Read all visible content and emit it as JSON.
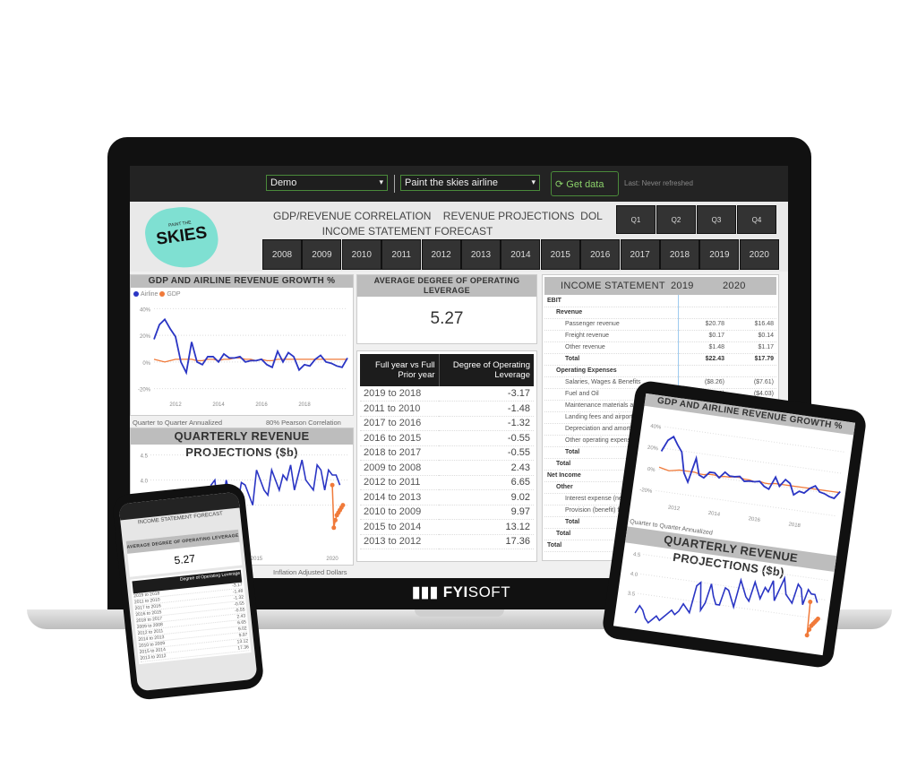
{
  "topbar": {
    "dataset": "Demo",
    "company": "Paint the skies airline",
    "get_data": "Get data",
    "last_refresh": "Last: Never refreshed"
  },
  "brand": {
    "logo_small": "PAINT THE",
    "logo_big": "SKIES",
    "footer_bold": "FYI",
    "footer_rest": "SOFT"
  },
  "header": {
    "title_line1": "GDP/REVENUE CORRELATION    REVENUE PROJECTIONS  DOL",
    "title_line2": "INCOME STATEMENT FORECAST",
    "quarters": [
      "Q1",
      "Q2",
      "Q3",
      "Q4"
    ],
    "years": [
      "2008",
      "2009",
      "2010",
      "2011",
      "2012",
      "2013",
      "2014",
      "2015",
      "2016",
      "2017",
      "2018",
      "2019",
      "2020"
    ]
  },
  "gdp_chart": {
    "title": "GDP AND AIRLINE REVENUE GROWTH %",
    "caption_left": "Quarter to Quarter Annualized",
    "caption_right": "80% Pearson Correlation"
  },
  "rev_chart": {
    "title": "QUARTERLY REVENUE PROJECTIONS ($b)",
    "caption": "Inflation Adjusted Dollars"
  },
  "dol": {
    "title": "AVERAGE DEGREE OF OPERATING LEVERAGE",
    "value": "5.27",
    "col1": "Full year vs Full Prior year",
    "col2": "Degree of Operating Leverage",
    "rows": [
      [
        "2019 to 2018",
        "-3.17"
      ],
      [
        "2011 to 2010",
        "-1.48"
      ],
      [
        "2017 to 2016",
        "-1.32"
      ],
      [
        "2016 to 2015",
        "-0.55"
      ],
      [
        "2018 to 2017",
        "-0.55"
      ],
      [
        "2009 to 2008",
        "2.43"
      ],
      [
        "2012 to 2011",
        "6.65"
      ],
      [
        "2014 to 2013",
        "9.02"
      ],
      [
        "2010 to 2009",
        "9.97"
      ],
      [
        "2015 to 2014",
        "13.12"
      ],
      [
        "2013 to 2012",
        "17.36"
      ]
    ]
  },
  "income": {
    "title": "INCOME STATEMENT",
    "col_2019": "2019",
    "col_2020": "2020",
    "rows": [
      {
        "label": "EBIT",
        "level": 0,
        "bold": true,
        "v19": "",
        "v20": ""
      },
      {
        "label": "Revenue",
        "level": 1,
        "bold": true,
        "v19": "",
        "v20": ""
      },
      {
        "label": "Passenger revenue",
        "level": 2,
        "bold": false,
        "v19": "$20.78",
        "v20": "$16.48"
      },
      {
        "label": "Freight revenue",
        "level": 2,
        "bold": false,
        "v19": "$0.17",
        "v20": "$0.14"
      },
      {
        "label": "Other revenue",
        "level": 2,
        "bold": false,
        "v19": "$1.48",
        "v20": "$1.17"
      },
      {
        "label": "Total",
        "level": 2,
        "bold": true,
        "v19": "$22.43",
        "v20": "$17.79"
      },
      {
        "label": "Operating Expenses",
        "level": 1,
        "bold": true,
        "v19": "",
        "v20": ""
      },
      {
        "label": "Salaries, Wages & Benefits",
        "level": 2,
        "bold": false,
        "v19": "($8.26)",
        "v20": "($7.61)"
      },
      {
        "label": "Fuel and Oil",
        "level": 2,
        "bold": false,
        "v19": "($4.33)",
        "v20": "($4.03)"
      },
      {
        "label": "Maintenance materials and repairs",
        "level": 2,
        "bold": false,
        "v19": "",
        "v20": ""
      },
      {
        "label": "Landing fees and airport rentals",
        "level": 2,
        "bold": false,
        "v19": "",
        "v20": ""
      },
      {
        "label": "Depreciation and amortization",
        "level": 2,
        "bold": false,
        "v19": "",
        "v20": ""
      },
      {
        "label": "Other operating expenses",
        "level": 2,
        "bold": false,
        "v19": "",
        "v20": ""
      },
      {
        "label": "Total",
        "level": 2,
        "bold": true,
        "v19": "",
        "v20": ""
      },
      {
        "label": "Total",
        "level": 1,
        "bold": true,
        "v19": "",
        "v20": ""
      },
      {
        "label": "Net Income",
        "level": 0,
        "bold": true,
        "v19": "",
        "v20": ""
      },
      {
        "label": "Other",
        "level": 1,
        "bold": true,
        "v19": "",
        "v20": ""
      },
      {
        "label": "Interest expense (net)",
        "level": 2,
        "bold": false,
        "v19": "",
        "v20": ""
      },
      {
        "label": "Provision (benefit) for income",
        "level": 2,
        "bold": false,
        "v19": "",
        "v20": ""
      },
      {
        "label": "Total",
        "level": 2,
        "bold": true,
        "v19": "",
        "v20": ""
      },
      {
        "label": "Total",
        "level": 1,
        "bold": true,
        "v19": "",
        "v20": ""
      },
      {
        "label": "Total",
        "level": 0,
        "bold": true,
        "v19": "",
        "v20": ""
      }
    ]
  },
  "chart_data": [
    {
      "type": "line",
      "title": "GDP AND AIRLINE REVENUE GROWTH %",
      "x_start": 2011,
      "x_step": 0.25,
      "xticks": [
        "2012",
        "2014",
        "2016",
        "2018"
      ],
      "yticks": [
        "40%",
        "20%",
        "0%",
        "-20%"
      ],
      "ylim": [
        -25,
        45
      ],
      "grid": true,
      "legend": "top-left",
      "colors": {
        "Airline": "#2a35c4",
        "GDP": "#f07a3a"
      },
      "series": [
        {
          "name": "Airline",
          "values": [
            17,
            28,
            32,
            25,
            19,
            0,
            -8,
            15,
            0,
            -2,
            4,
            4,
            0,
            6,
            3,
            3,
            4,
            0,
            1,
            1,
            2,
            -2,
            -4,
            8,
            0,
            7,
            4,
            -6,
            -2,
            -3,
            2,
            5,
            0,
            -1,
            -3,
            -4,
            3
          ]
        },
        {
          "name": "GDP",
          "values": [
            2,
            1,
            0,
            1,
            2,
            2,
            2,
            2,
            1,
            1,
            2,
            2,
            1,
            2,
            2,
            3,
            3,
            2,
            2,
            1,
            2,
            1,
            1,
            2,
            2,
            2,
            2,
            2,
            2,
            2,
            2,
            2,
            2,
            2,
            2,
            2,
            2
          ]
        }
      ]
    },
    {
      "type": "line",
      "title": "QUARTERLY REVENUE PROJECTIONS ($b)",
      "x_start": 2008,
      "x_step": 0.25,
      "xticks": [
        "2015",
        "2020"
      ],
      "yticks": [
        "4.5",
        "4.0",
        "3.5"
      ],
      "ylim": [
        2.6,
        4.6
      ],
      "grid": true,
      "colors": {
        "actual": "#2a35c4",
        "forecast": "#f07a3a"
      },
      "series": [
        {
          "name": "actual",
          "values": [
            3.0,
            3.2,
            3.1,
            2.9,
            2.8,
            2.9,
            3.0,
            2.9,
            3.0,
            3.1,
            3.2,
            3.1,
            3.2,
            3.4,
            3.3,
            3.2,
            3.9,
            4.0,
            3.3,
            3.5,
            4.0,
            3.7,
            3.5,
            3.5,
            3.95,
            3.9,
            3.7,
            3.5,
            4.2,
            4.0,
            3.8,
            3.7,
            4.2,
            4.0,
            3.8,
            4.1,
            4.0,
            4.3,
            3.8,
            4.1,
            4.4,
            4.0,
            3.9,
            3.8,
            4.3,
            4.2,
            3.8,
            4.2,
            4.1,
            4.1,
            3.9
          ]
        },
        {
          "name": "forecast",
          "x_start": 2020,
          "values": [
            3.9,
            3.05,
            3.2,
            3.3,
            3.35,
            3.4,
            3.45,
            3.5
          ]
        }
      ]
    }
  ]
}
